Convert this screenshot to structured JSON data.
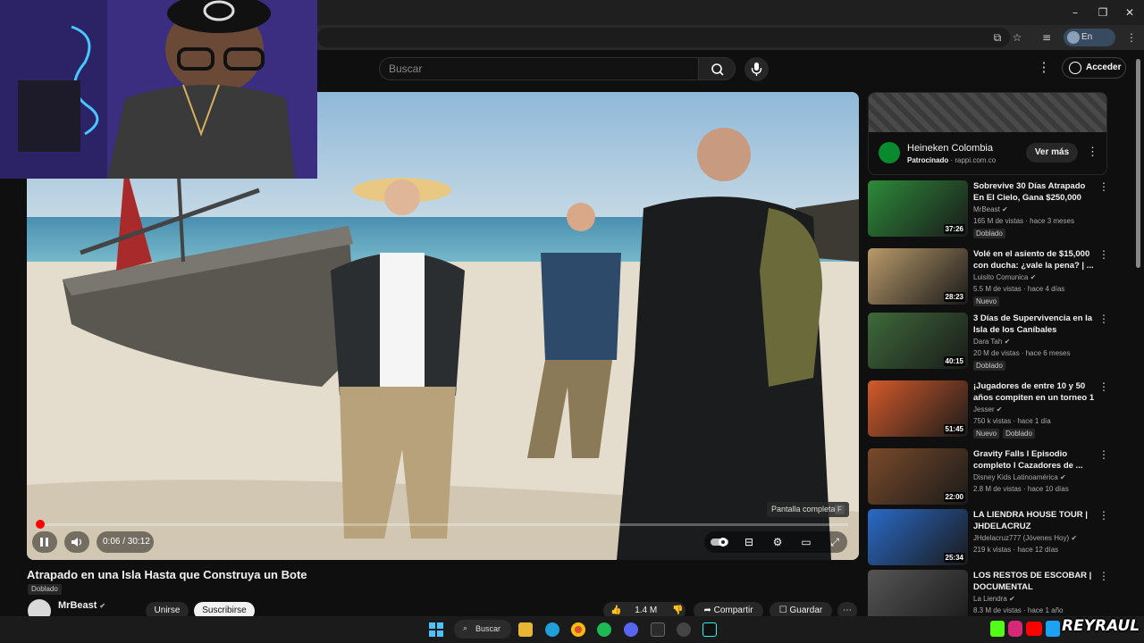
{
  "search": {
    "placeholder": "Buscar"
  },
  "header": {
    "login_label": "Acceder"
  },
  "browser": {
    "profile_status": "En pausa"
  },
  "player": {
    "time_display": "0:06 / 30:12",
    "progress_fraction": 0.0033,
    "tooltip_label": "Pantalla completa",
    "tooltip_key": "F"
  },
  "video": {
    "title": "Atrapado en una Isla Hasta que Construya un Bote",
    "dub_label": "Doblado",
    "channel": "MrBeast",
    "join_label": "Unirse",
    "subscribe_label": "Suscribirse",
    "likes": "1.4 M",
    "share_label": "Compartir",
    "save_label": "Guardar"
  },
  "ad": {
    "name": "Heineken Colombia",
    "sponsored_label": "Patrocinado",
    "domain": "rappi.com.co",
    "cta_label": "Ver más"
  },
  "recommendations": [
    {
      "title": "Sobrevive 30 Días Atrapado En El Cielo, Gana $250,000",
      "channel": "MrBeast",
      "meta": "165 M de vistas · hace 3 meses",
      "duration": "37:26",
      "badges": [
        "Doblado"
      ],
      "verified": true,
      "color": "#2d8a3a"
    },
    {
      "title": "Volé en el asiento de $15,000 con ducha: ¿vale la pena? | ...",
      "channel": "Luisito Comunica",
      "meta": "5.5 M de vistas · hace 4 días",
      "duration": "28:23",
      "badges": [
        "Nuevo"
      ],
      "verified": true,
      "color": "#b99a6a"
    },
    {
      "title": "3 Días de Supervivencia en la Isla de los Caníbales",
      "channel": "Dara Tah",
      "meta": "20 M de vistas · hace 6 meses",
      "duration": "40:15",
      "badges": [
        "Doblado"
      ],
      "verified": true,
      "color": "#3e6a3a"
    },
    {
      "title": "¡Jugadores de entre 10 y 50 años compiten en un torneo 1 ...",
      "channel": "Jesser",
      "meta": "750 k vistas · hace 1 día",
      "duration": "51:45",
      "badges": [
        "Nuevo",
        "Doblado"
      ],
      "verified": true,
      "color": "#d35a2a"
    },
    {
      "title": "Gravity Falls l Episodio completo l Cazadores de ...",
      "channel": "Disney Kids Latinoamérica",
      "meta": "2.8 M de vistas · hace 10 días",
      "duration": "22:00",
      "badges": [],
      "verified": true,
      "color": "#7a4a2a"
    },
    {
      "title": "LA LIENDRA HOUSE TOUR | JHDELACRUZ",
      "channel": "JHdelacruz777 (Jóvenes Hoy)",
      "meta": "219 k vistas · hace 12 días",
      "duration": "25:34",
      "badges": [],
      "verified": true,
      "color": "#2a6ac8"
    },
    {
      "title": "LOS RESTOS DE ESCOBAR | DOCUMENTAL",
      "channel": "La Liendra",
      "meta": "8.3 M de vistas · hace 1 año",
      "duration": "",
      "badges": [],
      "verified": true,
      "color": "#555555"
    }
  ],
  "taskbar": {
    "search_label": "Buscar"
  },
  "brand": {
    "text": "REYRAUL"
  },
  "colors": {
    "accent": "#ff0000",
    "background": "#0f0f0f"
  }
}
